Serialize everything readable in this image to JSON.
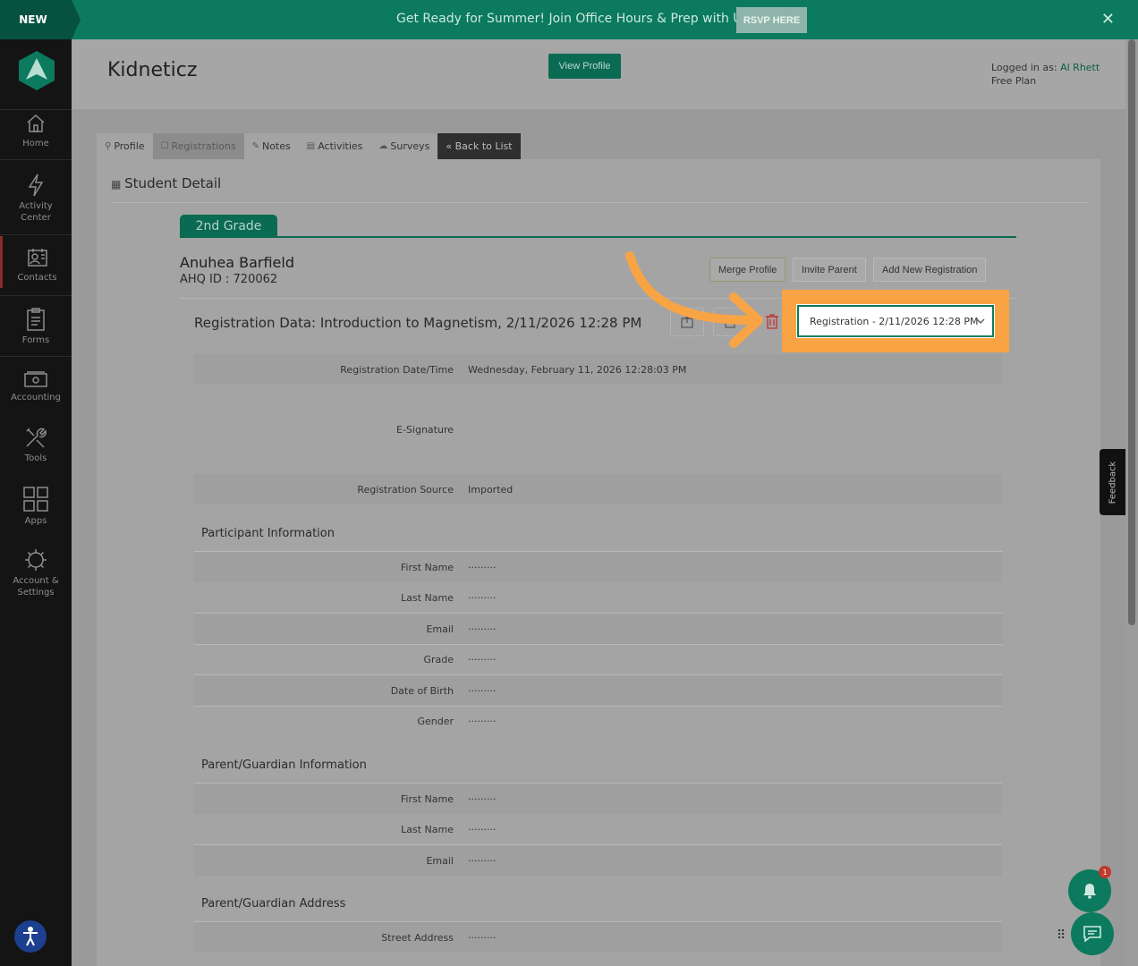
{
  "banner": {
    "badge": "NEW",
    "text": "Get Ready for Summer! Join Office Hours & Prep with Us",
    "cta": "RSVP HERE",
    "close_icon": "close-icon"
  },
  "sidebar": {
    "items": [
      {
        "label": "Home",
        "icon": "home-icon"
      },
      {
        "label": "Activity\nCenter",
        "icon": "lightning-icon"
      },
      {
        "label": "Contacts",
        "icon": "contacts-icon"
      },
      {
        "label": "Forms",
        "icon": "clipboard-icon"
      },
      {
        "label": "Accounting",
        "icon": "money-icon"
      },
      {
        "label": "Tools",
        "icon": "tools-icon"
      },
      {
        "label": "Apps",
        "icon": "apps-grid-icon"
      },
      {
        "label": "Account &\nSettings",
        "icon": "gear-icon"
      }
    ]
  },
  "header": {
    "title": "Kidneticz",
    "view_profile": "View Profile",
    "logged_in_prefix": "Logged in as:",
    "user": "Al Rhett",
    "plan": "Free Plan"
  },
  "tabs": [
    {
      "label": "Profile",
      "icon": "profile-icon"
    },
    {
      "label": "Registrations",
      "icon": "registrations-icon"
    },
    {
      "label": "Notes",
      "icon": "notes-icon"
    },
    {
      "label": "Activities",
      "icon": "activities-icon"
    },
    {
      "label": "Surveys",
      "icon": "surveys-icon"
    },
    {
      "label": "« Back to List"
    }
  ],
  "page": {
    "section_title": "Student Detail",
    "grade_tab": "2nd Grade",
    "student_name": "Anuhea Barfield",
    "student_id": "AHQ ID : 720062",
    "buttons": {
      "merge": "Merge Profile",
      "invite": "Invite Parent",
      "add": "Add New Registration"
    },
    "registration_title": "Registration Data: Introduction to Magnetism, 2/11/2026 12:28 PM",
    "registration_select": "Registration - 2/11/2026 12:28 PM"
  },
  "registration_rows": [
    {
      "label": "Registration Date/Time",
      "value": "Wednesday, February 11, 2026 12:28:03 PM"
    },
    {
      "label": "E-Signature",
      "value": ""
    },
    {
      "label": "Registration Source",
      "value": "Imported"
    }
  ],
  "participant": {
    "title": "Participant Information",
    "rows": [
      {
        "label": "First Name",
        "value": "·········"
      },
      {
        "label": "Last Name",
        "value": "·········"
      },
      {
        "label": "Email",
        "value": "·········"
      },
      {
        "label": "Grade",
        "value": "·········"
      },
      {
        "label": "Date of Birth",
        "value": "·········"
      },
      {
        "label": "Gender",
        "value": "·········"
      }
    ]
  },
  "guardian": {
    "title": "Parent/Guardian Information",
    "rows": [
      {
        "label": "First Name",
        "value": "·········"
      },
      {
        "label": "Last Name",
        "value": "·········"
      },
      {
        "label": "Email",
        "value": "·········"
      }
    ]
  },
  "address": {
    "title": "Parent/Guardian Address",
    "rows": [
      {
        "label": "Street Address",
        "value": "·········"
      }
    ]
  },
  "widgets": {
    "feedback": "Feedback",
    "notification_count": "1"
  },
  "colors": {
    "brand_green": "#0b7a5f",
    "highlight_orange": "#f9a444"
  }
}
